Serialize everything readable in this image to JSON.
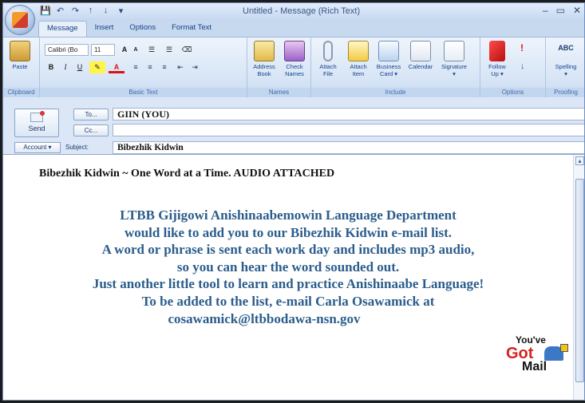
{
  "window": {
    "title": "Untitled - Message (Rich Text)",
    "minimize": "–",
    "maximize": "▭",
    "close": "✕"
  },
  "quick_access": {
    "save": "💾",
    "undo": "↶",
    "redo": "↷",
    "arrow_up": "↑",
    "arrow_down": "↓",
    "customize": "▾"
  },
  "tabs": [
    {
      "label": "Message",
      "active": true
    },
    {
      "label": "Insert",
      "active": false
    },
    {
      "label": "Options",
      "active": false
    },
    {
      "label": "Format Text",
      "active": false
    }
  ],
  "ribbon": {
    "clipboard": {
      "paste": "Paste",
      "label": "Clipboard"
    },
    "basic_text": {
      "font": "Calibri (Bo",
      "size": "11",
      "grow": "A",
      "shrink": "A",
      "bullets": "☰",
      "numbering": "☰",
      "clear": "⌫",
      "bold": "B",
      "italic": "I",
      "underline": "U",
      "highlight": "✎",
      "font_color": "A",
      "align_left": "≡",
      "align_center": "≡",
      "align_right": "≡",
      "decrease_indent": "⇤",
      "increase_indent": "⇥",
      "label": "Basic Text"
    },
    "names": {
      "address_book": [
        "Address",
        "Book"
      ],
      "check_names": [
        "Check",
        "Names"
      ],
      "label": "Names"
    },
    "include": {
      "attach_file": [
        "Attach",
        "File"
      ],
      "attach_item": [
        "Attach",
        "Item"
      ],
      "business_card": [
        "Business",
        "Card ▾"
      ],
      "calendar": [
        "Calendar",
        ""
      ],
      "signature": [
        "Signature",
        "▾"
      ],
      "label": "Include"
    },
    "options": {
      "follow_up": [
        "Follow",
        "Up ▾"
      ],
      "label": "Options"
    },
    "proofing": {
      "spelling": [
        "Spelling",
        "▾"
      ],
      "label": "Proofing",
      "abc": "ABC"
    }
  },
  "header": {
    "send_label": "Send",
    "to_label": "To...",
    "to_value": "GIIN (YOU)",
    "cc_label": "Cc...",
    "cc_value": "",
    "account_label": "Account ▾",
    "subject_label": "Subject:",
    "subject_value": "Bibezhik Kidwin"
  },
  "message": {
    "intro": "Bibezhik Kidwin ~ One Word at a Time.  AUDIO ATTACHED",
    "lines": [
      "LTBB Gijigowi Anishinaabemowin Language Department",
      "would like to add you to our Bibezhik Kidwin e-mail list.",
      "A word or phrase is sent each work day and includes mp3 audio,",
      "so you can hear the word sounded out.",
      "Just another little tool to learn and practice Anishinaabe Language!",
      "To be added to the list, e-mail Carla Osawamick at",
      "cosawamick@ltbbodawa-nsn.gov"
    ],
    "badge": {
      "line1": "You've",
      "line2": "Got",
      "line3": "Mail"
    }
  },
  "colors": {
    "text_blue": "#2b5d8c",
    "ribbon_blue": "#15428b",
    "badge_red": "#d62323"
  }
}
